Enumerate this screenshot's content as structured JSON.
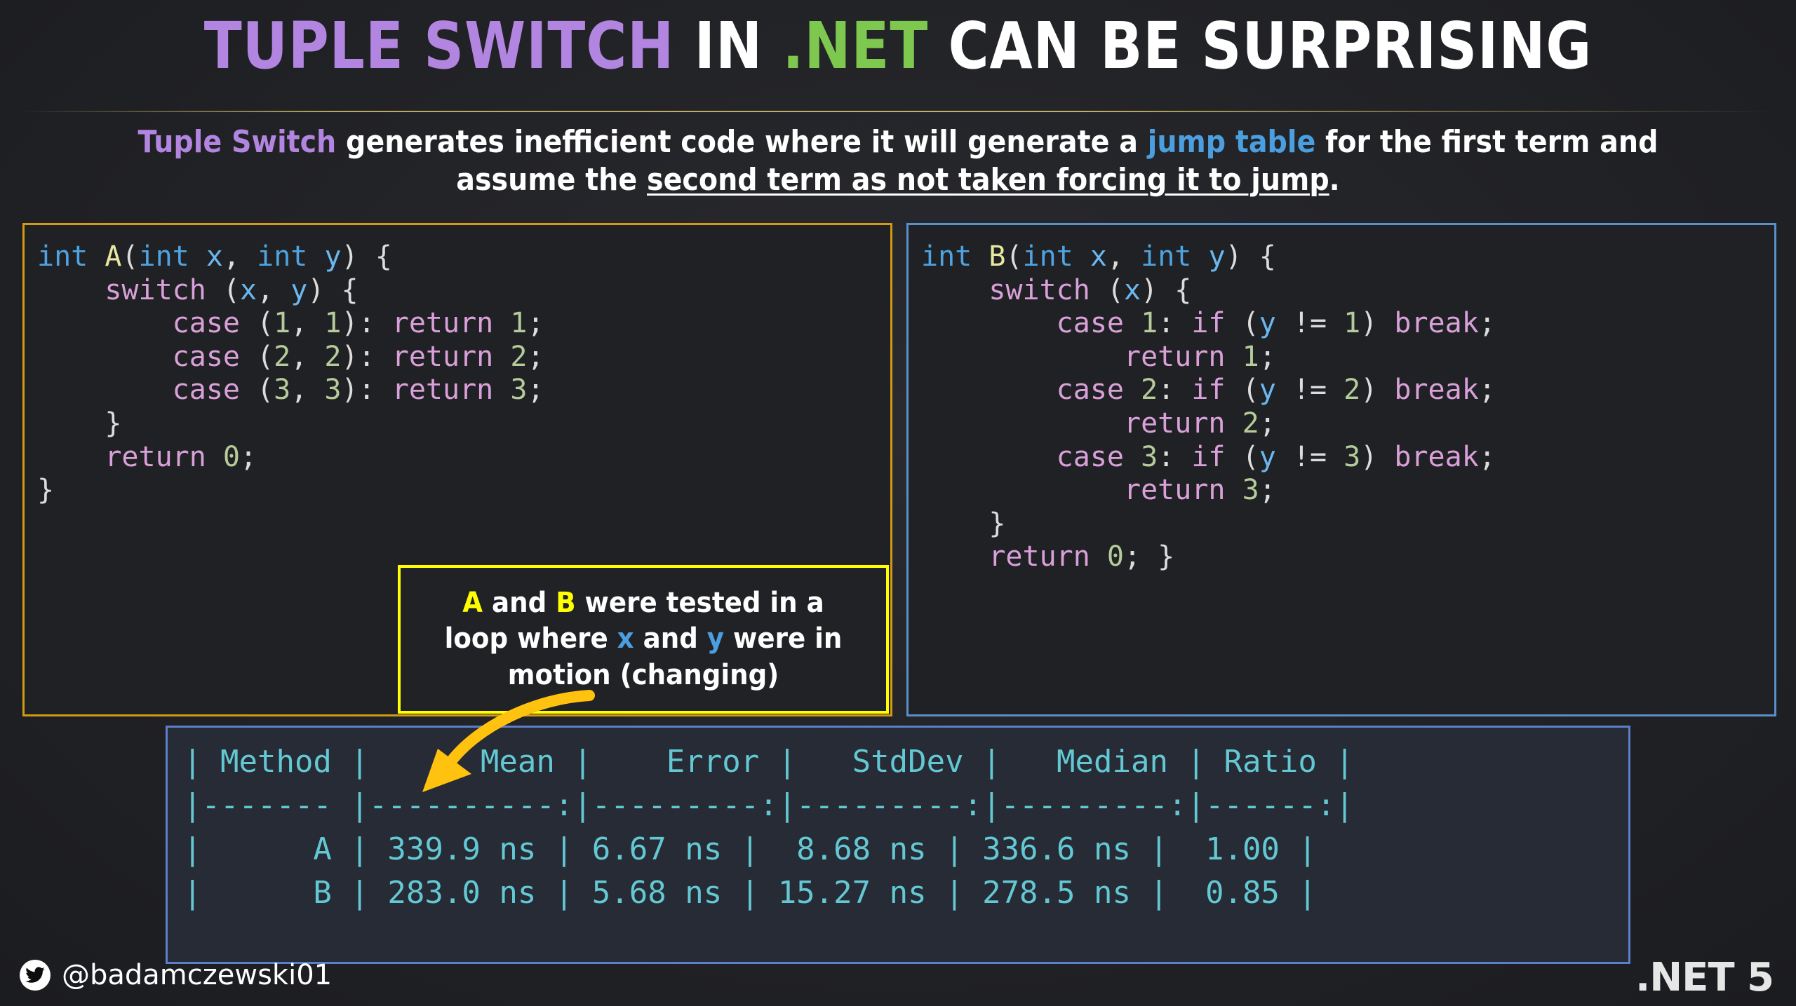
{
  "title": {
    "part1": "TUPLE SWITCH",
    "part2": " IN ",
    "part3": ".NET",
    "part4": " CAN BE SURPRISING",
    "colors": {
      "accent_purple": "#b285e0",
      "accent_green": "#7ec850",
      "white": "#ffffff"
    }
  },
  "subtitle": {
    "lead": "Tuple Switch",
    "mid1": " generates inefficient code where it will generate a ",
    "link": "jump table",
    "mid2": " for the first term and assume the ",
    "underlined": "second term as not taken forcing it to jump",
    "end": ".",
    "link_color": "#4b9fe0"
  },
  "code_a": {
    "border_color": "#d19a10",
    "lines": [
      [
        {
          "t": "int ",
          "c": "k-type"
        },
        {
          "t": "A",
          "c": "k-fn"
        },
        {
          "t": "(",
          "c": "k-punc"
        },
        {
          "t": "int ",
          "c": "k-type"
        },
        {
          "t": "x",
          "c": "k-var"
        },
        {
          "t": ", ",
          "c": "k-punc"
        },
        {
          "t": "int ",
          "c": "k-type"
        },
        {
          "t": "y",
          "c": "k-var"
        },
        {
          "t": ") {",
          "c": "k-punc"
        }
      ],
      [
        {
          "t": "    ",
          "c": "k-punc"
        },
        {
          "t": "switch",
          "c": "k-kw"
        },
        {
          "t": " (",
          "c": "k-punc"
        },
        {
          "t": "x",
          "c": "k-var"
        },
        {
          "t": ", ",
          "c": "k-punc"
        },
        {
          "t": "y",
          "c": "k-var"
        },
        {
          "t": ") {",
          "c": "k-punc"
        }
      ],
      [
        {
          "t": "        ",
          "c": "k-punc"
        },
        {
          "t": "case",
          "c": "k-kw"
        },
        {
          "t": " (",
          "c": "k-punc"
        },
        {
          "t": "1",
          "c": "k-num"
        },
        {
          "t": ", ",
          "c": "k-punc"
        },
        {
          "t": "1",
          "c": "k-num"
        },
        {
          "t": "): ",
          "c": "k-punc"
        },
        {
          "t": "return",
          "c": "k-kw"
        },
        {
          "t": " ",
          "c": "k-punc"
        },
        {
          "t": "1",
          "c": "k-num"
        },
        {
          "t": ";",
          "c": "k-punc"
        }
      ],
      [
        {
          "t": "        ",
          "c": "k-punc"
        },
        {
          "t": "case",
          "c": "k-kw"
        },
        {
          "t": " (",
          "c": "k-punc"
        },
        {
          "t": "2",
          "c": "k-num"
        },
        {
          "t": ", ",
          "c": "k-punc"
        },
        {
          "t": "2",
          "c": "k-num"
        },
        {
          "t": "): ",
          "c": "k-punc"
        },
        {
          "t": "return",
          "c": "k-kw"
        },
        {
          "t": " ",
          "c": "k-punc"
        },
        {
          "t": "2",
          "c": "k-num"
        },
        {
          "t": ";",
          "c": "k-punc"
        }
      ],
      [
        {
          "t": "        ",
          "c": "k-punc"
        },
        {
          "t": "case",
          "c": "k-kw"
        },
        {
          "t": " (",
          "c": "k-punc"
        },
        {
          "t": "3",
          "c": "k-num"
        },
        {
          "t": ", ",
          "c": "k-punc"
        },
        {
          "t": "3",
          "c": "k-num"
        },
        {
          "t": "): ",
          "c": "k-punc"
        },
        {
          "t": "return",
          "c": "k-kw"
        },
        {
          "t": " ",
          "c": "k-punc"
        },
        {
          "t": "3",
          "c": "k-num"
        },
        {
          "t": ";",
          "c": "k-punc"
        }
      ],
      [
        {
          "t": "    }",
          "c": "k-punc"
        }
      ],
      [
        {
          "t": "    ",
          "c": "k-punc"
        },
        {
          "t": "return",
          "c": "k-kw"
        },
        {
          "t": " ",
          "c": "k-punc"
        },
        {
          "t": "0",
          "c": "k-num"
        },
        {
          "t": ";",
          "c": "k-punc"
        }
      ],
      [
        {
          "t": "}",
          "c": "k-punc"
        }
      ]
    ]
  },
  "code_b": {
    "border_color": "#5b8fc9",
    "lines": [
      [
        {
          "t": "int ",
          "c": "k-type"
        },
        {
          "t": "B",
          "c": "k-fn"
        },
        {
          "t": "(",
          "c": "k-punc"
        },
        {
          "t": "int ",
          "c": "k-type"
        },
        {
          "t": "x",
          "c": "k-var"
        },
        {
          "t": ", ",
          "c": "k-punc"
        },
        {
          "t": "int ",
          "c": "k-type"
        },
        {
          "t": "y",
          "c": "k-var"
        },
        {
          "t": ") {",
          "c": "k-punc"
        }
      ],
      [
        {
          "t": "    ",
          "c": "k-punc"
        },
        {
          "t": "switch",
          "c": "k-kw"
        },
        {
          "t": " (",
          "c": "k-punc"
        },
        {
          "t": "x",
          "c": "k-var"
        },
        {
          "t": ") {",
          "c": "k-punc"
        }
      ],
      [
        {
          "t": "        ",
          "c": "k-punc"
        },
        {
          "t": "case",
          "c": "k-kw"
        },
        {
          "t": " ",
          "c": "k-punc"
        },
        {
          "t": "1",
          "c": "k-num"
        },
        {
          "t": ": ",
          "c": "k-punc"
        },
        {
          "t": "if",
          "c": "k-kw"
        },
        {
          "t": " (",
          "c": "k-punc"
        },
        {
          "t": "y",
          "c": "k-var"
        },
        {
          "t": " != ",
          "c": "k-punc"
        },
        {
          "t": "1",
          "c": "k-num"
        },
        {
          "t": ") ",
          "c": "k-punc"
        },
        {
          "t": "break",
          "c": "k-kw"
        },
        {
          "t": ";",
          "c": "k-punc"
        }
      ],
      [
        {
          "t": "            ",
          "c": "k-punc"
        },
        {
          "t": "return",
          "c": "k-kw"
        },
        {
          "t": " ",
          "c": "k-punc"
        },
        {
          "t": "1",
          "c": "k-num"
        },
        {
          "t": ";",
          "c": "k-punc"
        }
      ],
      [
        {
          "t": "        ",
          "c": "k-punc"
        },
        {
          "t": "case",
          "c": "k-kw"
        },
        {
          "t": " ",
          "c": "k-punc"
        },
        {
          "t": "2",
          "c": "k-num"
        },
        {
          "t": ": ",
          "c": "k-punc"
        },
        {
          "t": "if",
          "c": "k-kw"
        },
        {
          "t": " (",
          "c": "k-punc"
        },
        {
          "t": "y",
          "c": "k-var"
        },
        {
          "t": " != ",
          "c": "k-punc"
        },
        {
          "t": "2",
          "c": "k-num"
        },
        {
          "t": ") ",
          "c": "k-punc"
        },
        {
          "t": "break",
          "c": "k-kw"
        },
        {
          "t": ";",
          "c": "k-punc"
        }
      ],
      [
        {
          "t": "            ",
          "c": "k-punc"
        },
        {
          "t": "return",
          "c": "k-kw"
        },
        {
          "t": " ",
          "c": "k-punc"
        },
        {
          "t": "2",
          "c": "k-num"
        },
        {
          "t": ";",
          "c": "k-punc"
        }
      ],
      [
        {
          "t": "        ",
          "c": "k-punc"
        },
        {
          "t": "case",
          "c": "k-kw"
        },
        {
          "t": " ",
          "c": "k-punc"
        },
        {
          "t": "3",
          "c": "k-num"
        },
        {
          "t": ": ",
          "c": "k-punc"
        },
        {
          "t": "if",
          "c": "k-kw"
        },
        {
          "t": " (",
          "c": "k-punc"
        },
        {
          "t": "y",
          "c": "k-var"
        },
        {
          "t": " != ",
          "c": "k-punc"
        },
        {
          "t": "3",
          "c": "k-num"
        },
        {
          "t": ") ",
          "c": "k-punc"
        },
        {
          "t": "break",
          "c": "k-kw"
        },
        {
          "t": ";",
          "c": "k-punc"
        }
      ],
      [
        {
          "t": "            ",
          "c": "k-punc"
        },
        {
          "t": "return",
          "c": "k-kw"
        },
        {
          "t": " ",
          "c": "k-punc"
        },
        {
          "t": "3",
          "c": "k-num"
        },
        {
          "t": ";",
          "c": "k-punc"
        }
      ],
      [
        {
          "t": "    }",
          "c": "k-punc"
        }
      ],
      [
        {
          "t": "    ",
          "c": "k-punc"
        },
        {
          "t": "return",
          "c": "k-kw"
        },
        {
          "t": " ",
          "c": "k-punc"
        },
        {
          "t": "0",
          "c": "k-num"
        },
        {
          "t": "; }",
          "c": "k-punc"
        }
      ]
    ]
  },
  "callout": {
    "border_color": "#ffff00",
    "seg": [
      {
        "t": "A",
        "c": "c-yellow"
      },
      {
        "t": " and ",
        "c": ""
      },
      {
        "t": "B",
        "c": "c-yellow"
      },
      {
        "t": " were tested in a loop where ",
        "c": ""
      },
      {
        "t": "x",
        "c": "c-blue"
      },
      {
        "t": " and ",
        "c": ""
      },
      {
        "t": "y",
        "c": "c-blue"
      },
      {
        "t": " were in motion (changing)",
        "c": ""
      }
    ],
    "arrow_color": "#ffc20e"
  },
  "chart_data": {
    "type": "table",
    "title": "BenchmarkDotNet results",
    "columns": [
      "Method",
      "Mean",
      "Error",
      "StdDev",
      "Median",
      "Ratio"
    ],
    "rows": [
      {
        "Method": "A",
        "Mean": "339.9 ns",
        "Error": "6.67 ns",
        "StdDev": "8.68 ns",
        "Median": "336.6 ns",
        "Ratio": "1.00"
      },
      {
        "Method": "B",
        "Mean": "283.0 ns",
        "Error": "5.68 ns",
        "StdDev": "15.27 ns",
        "Median": "278.5 ns",
        "Ratio": "0.85"
      }
    ],
    "raw_lines": [
      "| Method |      Mean |    Error |   StdDev |   Median | Ratio |",
      "|------- |----------:|---------:|---------:|---------:|------:|",
      "|      A | 339.9 ns | 6.67 ns |  8.68 ns | 336.6 ns |  1.00 |",
      "|      B | 283.0 ns | 5.68 ns | 15.27 ns | 278.5 ns |  0.85 |"
    ],
    "text_color": "#63c8d3",
    "border_color": "#5b7fc9"
  },
  "footer": {
    "handle": "@badamczewski01",
    "twitter_icon": "twitter-bird-icon",
    "net_version": ".NET 5"
  }
}
